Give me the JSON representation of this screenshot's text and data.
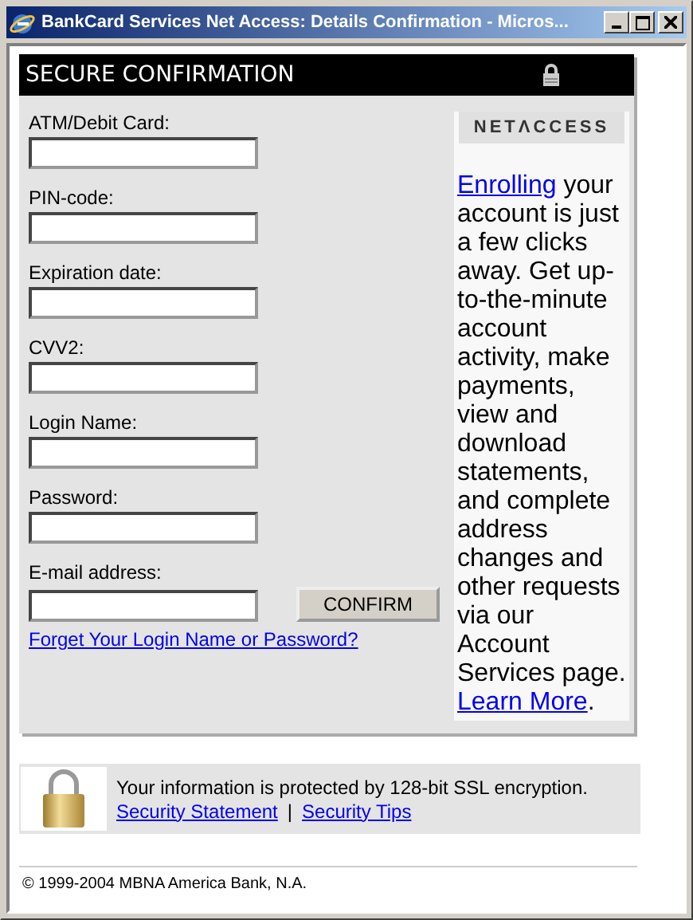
{
  "window": {
    "title": "BankCard Services Net Access: Details Confirmation - Micros..."
  },
  "header": {
    "title": "SECURE CONFIRMATION"
  },
  "fields": [
    {
      "label": "ATM/Debit Card:"
    },
    {
      "label": "PIN-code:"
    },
    {
      "label": "Expiration date:"
    },
    {
      "label": "CVV2:"
    },
    {
      "label": "Login Name:"
    },
    {
      "label": "Password:"
    },
    {
      "label": "E-mail address:"
    }
  ],
  "confirm_button": "CONFIRM",
  "forgot_link": "Forget Your Login Name or Password?",
  "sidebar": {
    "logo": "NETΛCCESS",
    "promo": [
      {
        "kind": "link",
        "text": "Enrolling"
      },
      {
        "kind": "text",
        "text": " your account is just a few clicks away. Get up-to-the-minute account activity, make payments, view and download statements, and complete address changes and other requests via our Account Services page. "
      },
      {
        "kind": "link",
        "text": "Learn More"
      },
      {
        "kind": "text",
        "text": "."
      }
    ]
  },
  "security": {
    "message": "Your information is protected by 128-bit SSL encryption.",
    "links": [
      "Security Statement",
      "Security Tips"
    ],
    "separator": "|"
  },
  "copyright": "© 1999-2004 MBNA America Bank, N.A."
}
